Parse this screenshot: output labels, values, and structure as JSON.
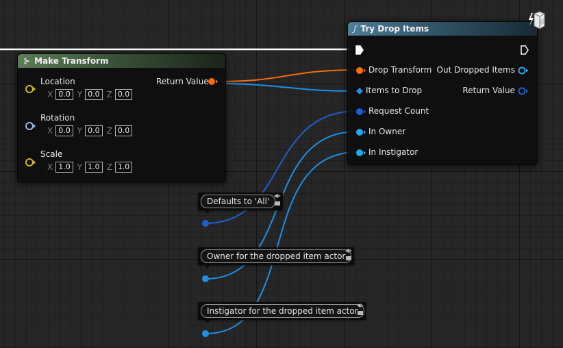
{
  "make_transform": {
    "title": "Make Transform",
    "return_label": "Return Value",
    "location": {
      "label": "Location",
      "x": "0.0",
      "y": "0.0",
      "z": "0.0"
    },
    "rotation": {
      "label": "Rotation",
      "x": "0.0",
      "y": "0.0",
      "z": "0.0"
    },
    "scale": {
      "label": "Scale",
      "x": "1.0",
      "y": "1.0",
      "z": "1.0"
    },
    "axis_x": "X",
    "axis_y": "Y",
    "axis_z": "Z"
  },
  "try_drop_items": {
    "title": "Try Drop Items",
    "inputs": [
      "Drop Transform",
      "Items to Drop",
      "Request Count",
      "In Owner",
      "In Instigator"
    ],
    "outputs": [
      "Out Dropped Items",
      "Return Value"
    ]
  },
  "comments": [
    "Defaults to 'All'",
    "Owner for the dropped item actor",
    "Instigator for the dropped item actor"
  ],
  "colors": {
    "vector_pin": "#d8b61e",
    "rotator_pin": "#9fb4f2",
    "struct_pin": "#f46e0c",
    "object_pin": "#25a7ee",
    "int_pin": "#1e5fcf",
    "array_pin": "#1f8fe6",
    "exec_wire": "#ffffff"
  },
  "icons": [
    "function-icon",
    "make-transform-icon",
    "cube-icon",
    "pin-icon"
  ]
}
